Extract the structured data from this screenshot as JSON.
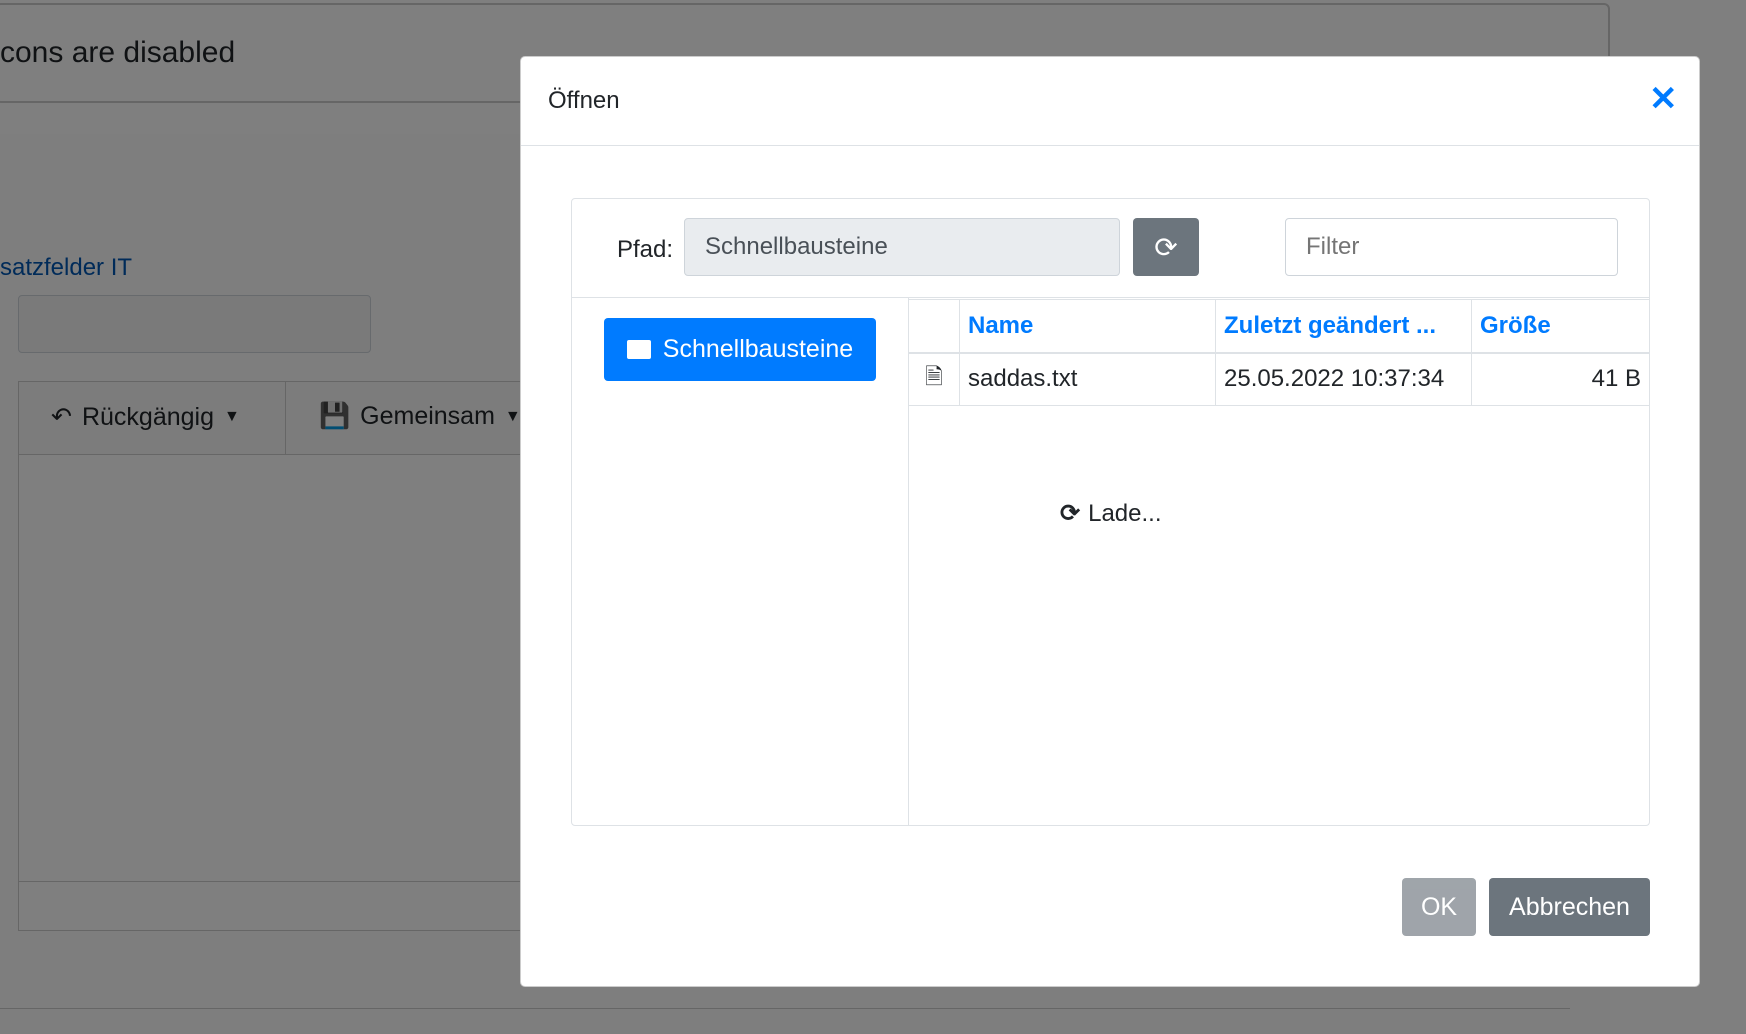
{
  "background": {
    "heading": "cons are disabled",
    "link": "satzfelder IT",
    "toolbar": {
      "undo": "Rückgängig",
      "shared": "Gemeinsam"
    }
  },
  "dialog": {
    "title": "Öffnen",
    "path_label": "Pfad:",
    "path_value": "Schnellbausteine",
    "filter_placeholder": "Filter",
    "folder": "Schnellbausteine",
    "table": {
      "headers": [
        "Name",
        "Zuletzt geändert ...",
        "Größe"
      ],
      "rows": [
        {
          "icon": "text-file-icon",
          "name": "saddas.txt",
          "modified": "25.05.2022 10:37:34",
          "size": "41 B"
        }
      ]
    },
    "loading": "Lade...",
    "ok": "OK",
    "cancel": "Abbrechen"
  },
  "colors": {
    "primary": "#007bff",
    "secondary": "#6c757d"
  }
}
